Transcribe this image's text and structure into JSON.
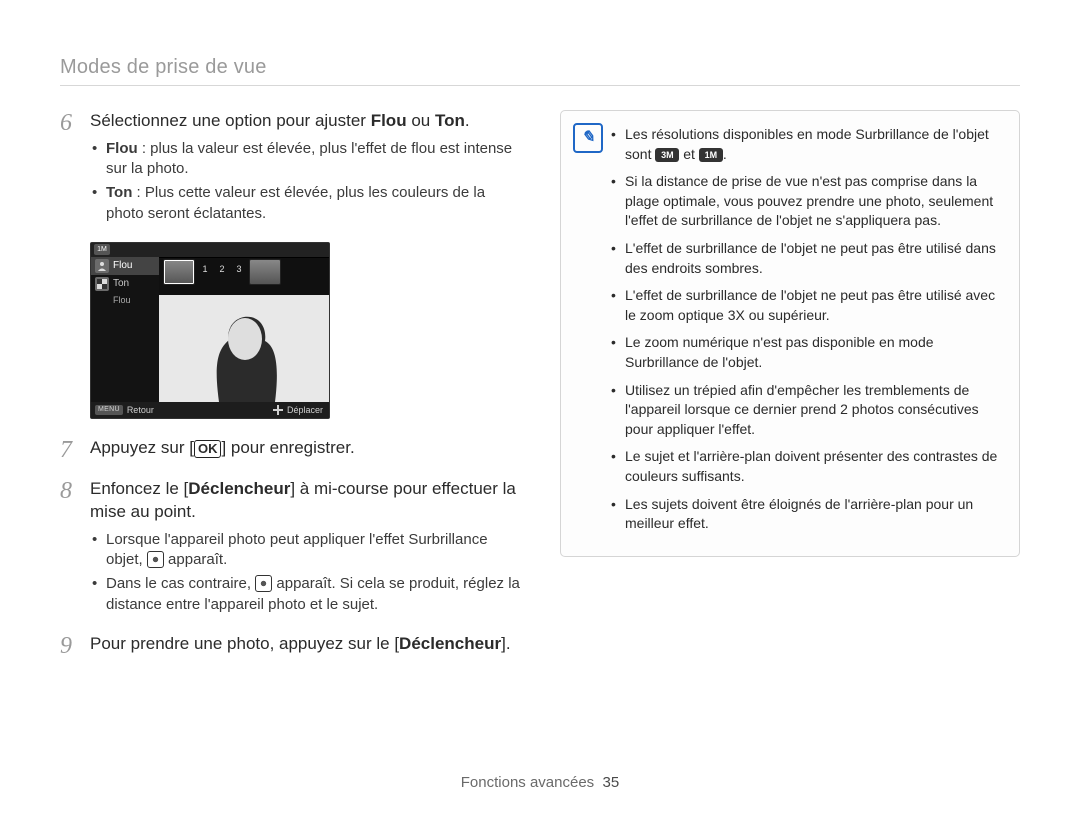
{
  "header": {
    "section_title": "Modes de prise de vue"
  },
  "steps": {
    "s6": {
      "num": "6",
      "lead_prefix": "Sélectionnez une option pour ajuster ",
      "bold_a": "Flou",
      "mid": " ou ",
      "bold_b": "Ton",
      "suffix": ".",
      "bullets": {
        "b1_label": "Flou",
        "b1_text": " : plus la valeur est élevée, plus l'effet de flou est intense sur la photo.",
        "b2_label": "Ton",
        "b2_text": " : Plus cette valeur est élevée, plus les couleurs de la photo seront éclatantes."
      }
    },
    "s7": {
      "num": "7",
      "pre": "Appuyez sur [",
      "key": "OK",
      "post": "] pour enregistrer."
    },
    "s8": {
      "num": "8",
      "pre": "Enfoncez le [",
      "bold": "Déclencheur",
      "post": "] à mi-course pour effectuer la mise au point.",
      "bullets": {
        "b1_pre": "Lorsque l'appareil photo peut appliquer l'effet Surbrillance objet, ",
        "b1_post": " apparaît.",
        "b2_pre": "Dans le cas contraire, ",
        "b2_post": " apparaît. Si cela se produit, réglez la distance entre l'appareil photo et le sujet."
      }
    },
    "s9": {
      "num": "9",
      "pre": "Pour prendre une photo, appuyez sur le [",
      "bold": "Déclencheur",
      "post": "]."
    }
  },
  "camera_ui": {
    "mode_badge": "1M",
    "opt1": "Flou",
    "opt2": "Ton",
    "opt3": "Flou",
    "scale": {
      "n1": "1",
      "n2": "2",
      "n3": "3"
    },
    "menu_label": "MENU",
    "back_label": "Retour",
    "move_label": "Déplacer"
  },
  "notes": {
    "n1_pre": "Les résolutions disponibles en mode Surbrillance de l'objet sont ",
    "n1_badge_a": "3M",
    "n1_mid": " et ",
    "n1_badge_b": "1M",
    "n1_post": ".",
    "n2": "Si la distance de prise de vue n'est pas comprise dans la plage optimale, vous pouvez prendre une photo, seulement l'effet de surbrillance de l'objet ne s'appliquera pas.",
    "n3": "L'effet de surbrillance de l'objet ne peut pas être utilisé dans des endroits sombres.",
    "n4": "L'effet de surbrillance de l'objet ne peut pas être utilisé avec le zoom optique 3X ou supérieur.",
    "n5": "Le zoom numérique n'est pas disponible en mode Surbrillance de l'objet.",
    "n6": "Utilisez un trépied afin d'empêcher les tremblements de l'appareil lorsque ce dernier prend 2 photos consécutives pour appliquer l'effet.",
    "n7": "Le sujet et l'arrière-plan doivent présenter des contrastes de couleurs suffisants.",
    "n8": "Les sujets doivent être éloignés de l'arrière-plan pour un meilleur effet."
  },
  "footer": {
    "section": "Fonctions avancées",
    "page": "35"
  }
}
